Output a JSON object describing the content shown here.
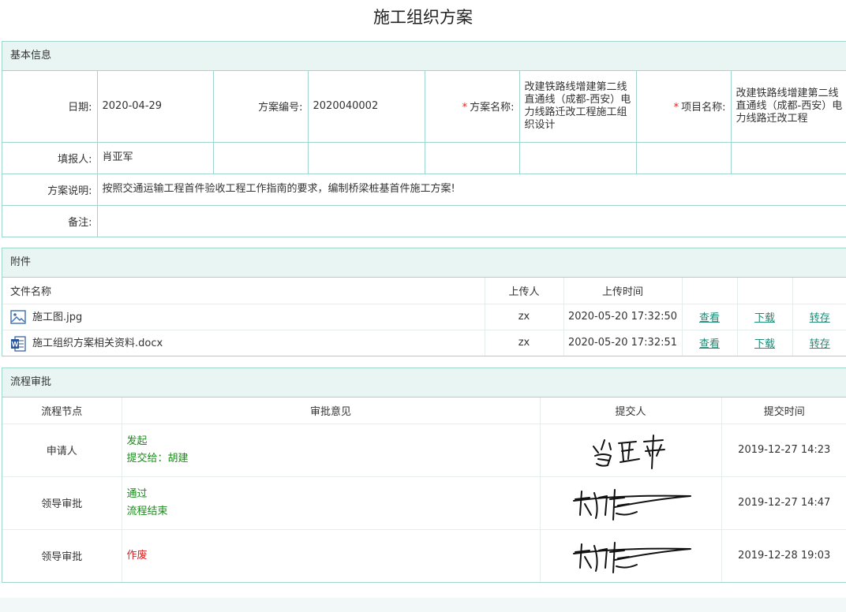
{
  "title": "施工组织方案",
  "basic": {
    "section_title": "基本信息",
    "date_label": "日期:",
    "date_value": "2020-04-29",
    "code_label": "方案编号:",
    "code_value": "2020040002",
    "plan_name_label": "方案名称:",
    "plan_name_value": "改建铁路线增建第二线直通线（成都-西安）电力线路迁改工程施工组织设计",
    "project_name_label": "项目名称:",
    "project_name_value": "改建铁路线增建第二线直通线（成都-西安）电力线路迁改工程",
    "filler_label": "填报人:",
    "filler_value": "肖亚军",
    "desc_label": "方案说明:",
    "desc_value": "按照交通运输工程首件验收工程工作指南的要求，编制桥梁桩基首件施工方案!",
    "remark_label": "备注:",
    "remark_value": "",
    "required_mark": "*"
  },
  "attachments": {
    "section_title": "附件",
    "headers": {
      "name": "文件名称",
      "uploader": "上传人",
      "time": "上传时间"
    },
    "view_label": "查看",
    "download_label": "下载",
    "transfer_label": "转存",
    "files": [
      {
        "name": "施工图.jpg",
        "icon": "image-file-icon",
        "uploader": "zx",
        "time": "2020-05-20 17:32:50"
      },
      {
        "name": "施工组织方案相关资料.docx",
        "icon": "word-file-icon",
        "uploader": "zx",
        "time": "2020-05-20 17:32:51"
      }
    ]
  },
  "flow": {
    "section_title": "流程审批",
    "headers": {
      "node": "流程节点",
      "opinion": "审批意见",
      "submitter": "提交人",
      "time": "提交时间"
    },
    "rows": [
      {
        "node": "申请人",
        "opinion1": "发起",
        "opinion2": "提交给：胡建",
        "signature": "signature-肖亚军",
        "time": "2019-12-27 14:23"
      },
      {
        "node": "领导审批",
        "opinion1": "通过",
        "opinion2": "流程结束",
        "signature": "signature-胡建",
        "time": "2019-12-27 14:47"
      },
      {
        "node": "领导审批",
        "opinion1": "作废",
        "opinion2": "",
        "signature": "signature-胡建",
        "time": "2019-12-28 19:03"
      }
    ]
  },
  "colors": {
    "border": "#9fd5cd",
    "header_bg": "#e8f5f3",
    "link": "#1d8b75",
    "approved_text": "#1a8a1a",
    "void_text": "#e02020"
  }
}
